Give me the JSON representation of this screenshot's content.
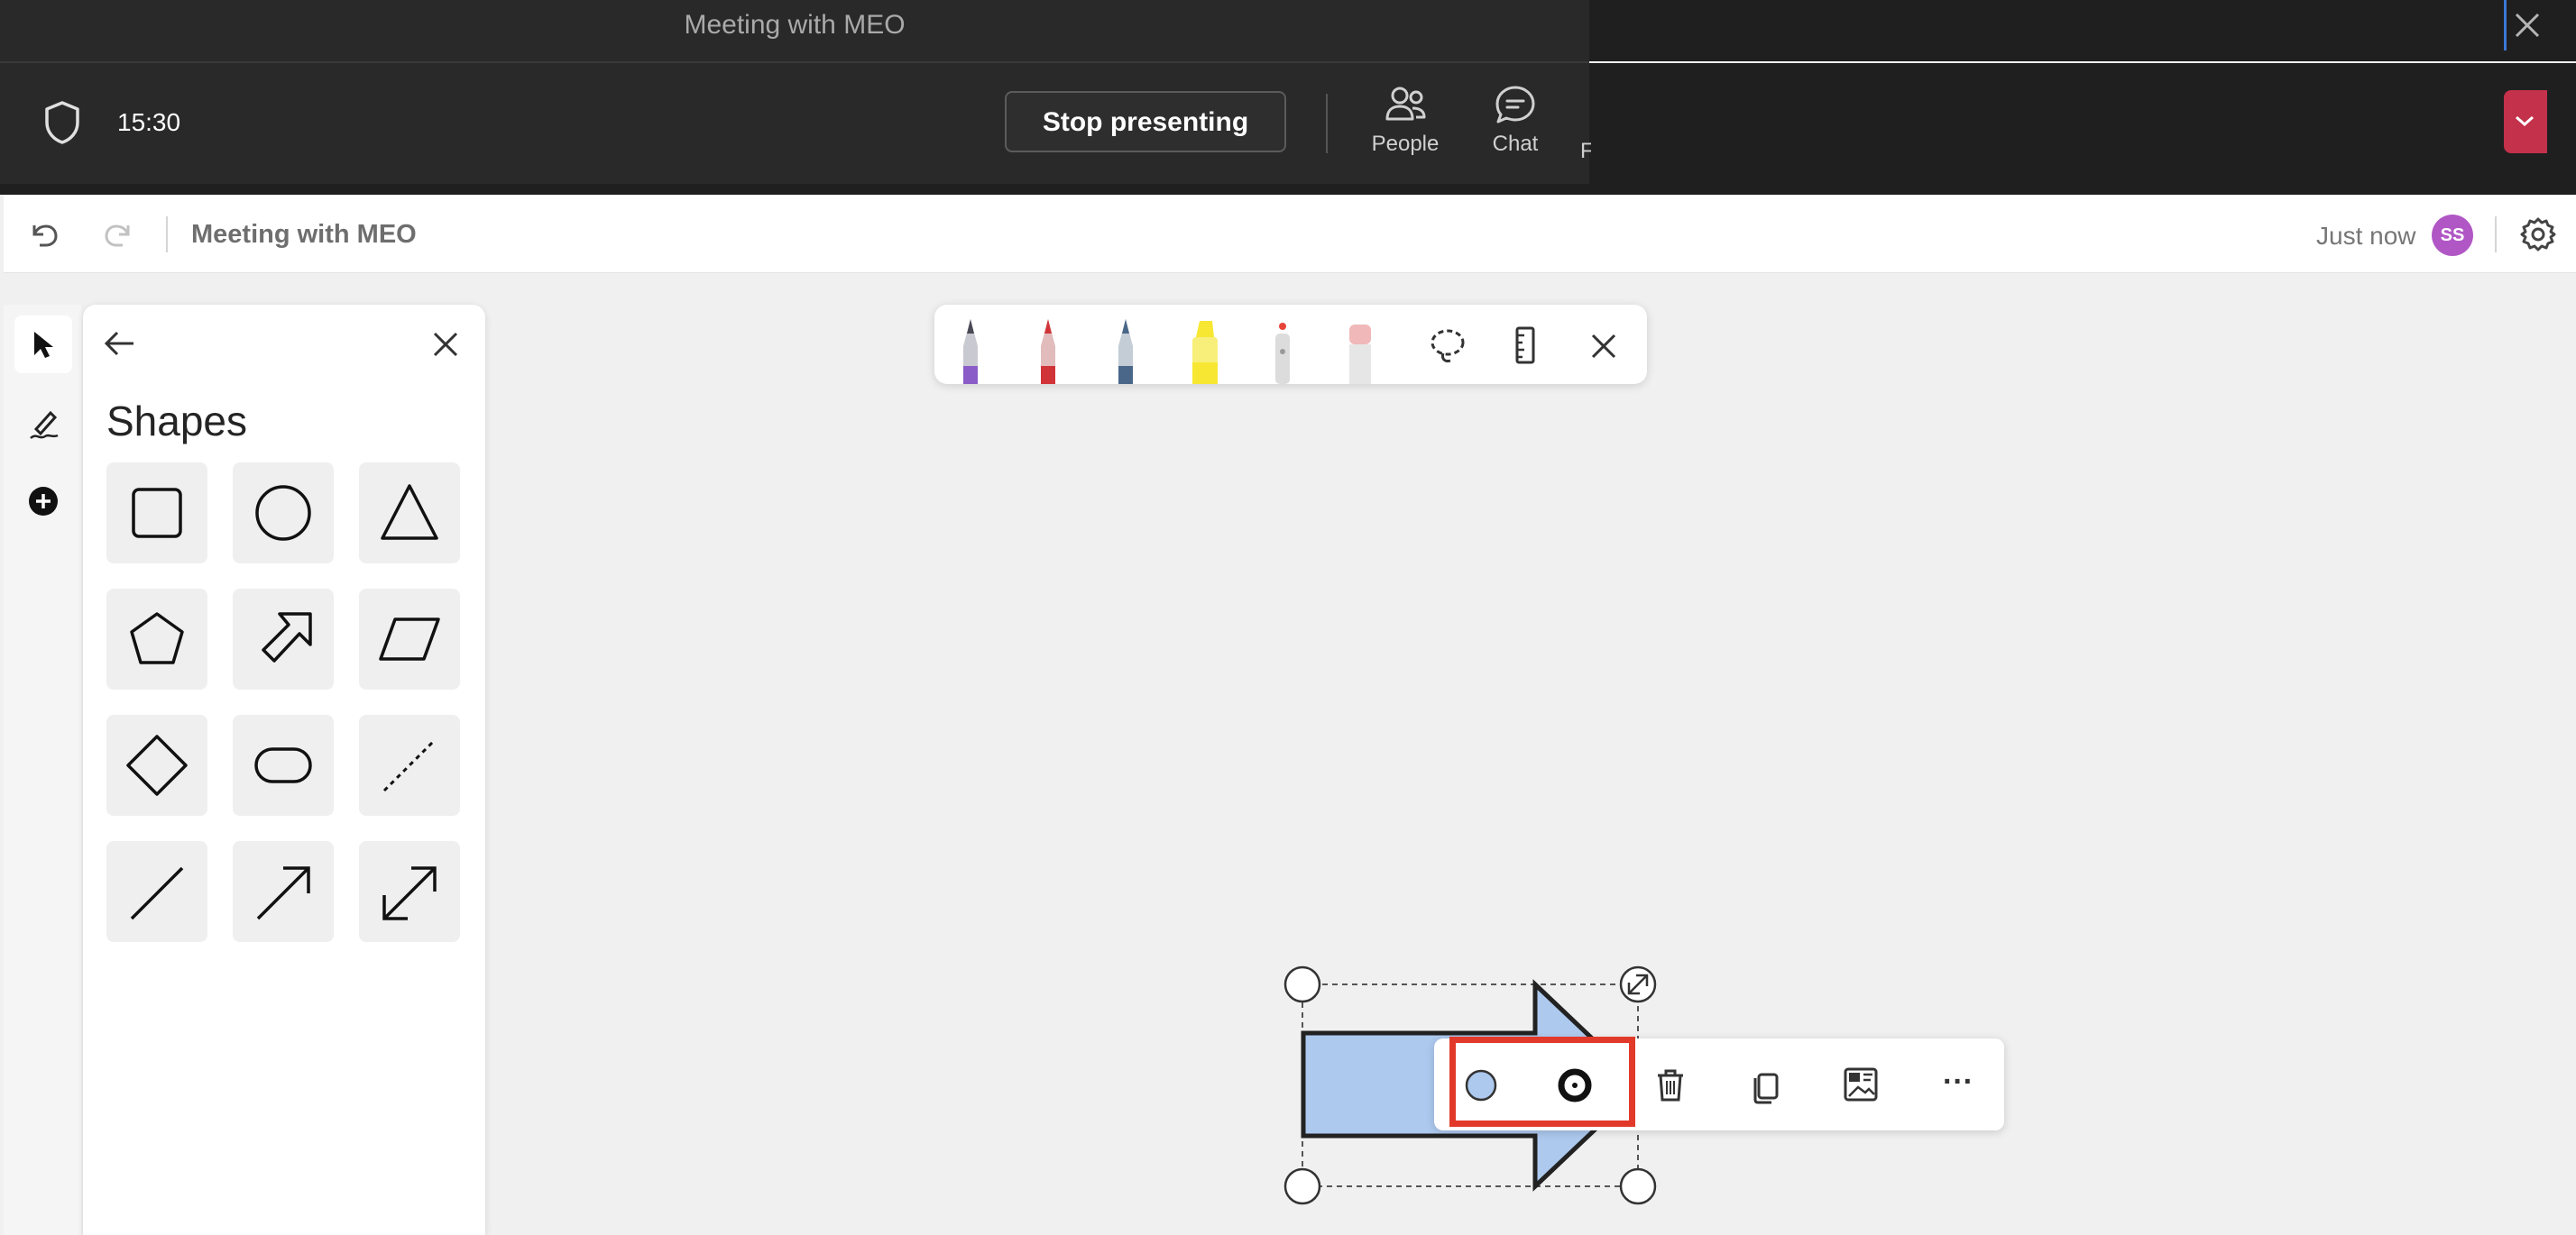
{
  "window": {
    "title": "Meeting with MEO"
  },
  "meeting_bar": {
    "timer": "15:30",
    "stop_presenting_label": "Stop presenting",
    "people_label": "People",
    "chat_label": "Chat",
    "cut_label": "F"
  },
  "whiteboard": {
    "title": "Meeting with MEO",
    "save_status": "Just now",
    "avatar_initials": "SS",
    "avatar_color": "#b057c5"
  },
  "shapes_panel": {
    "title": "Shapes",
    "shapes": [
      "square",
      "circle",
      "triangle",
      "pentagon",
      "arrow-block",
      "parallelogram",
      "diamond",
      "rounded-rectangle",
      "dashed-line",
      "line",
      "arrow",
      "double-arrow"
    ]
  },
  "pen_toolbar": {
    "pens": [
      {
        "name": "purple-pen",
        "color": "#8a5cc7"
      },
      {
        "name": "red-pen",
        "color": "#d13438"
      },
      {
        "name": "blue-pen",
        "color": "#4a6789"
      },
      {
        "name": "yellow-highlighter",
        "color": "#f7e733"
      },
      {
        "name": "red-laser",
        "color": "#e8443a"
      },
      {
        "name": "eraser",
        "color": "#f0b8b8"
      }
    ]
  },
  "canvas_shape": {
    "fill_color": "#adc9ee",
    "outline_color": "#222222",
    "type": "block-arrow"
  },
  "context_toolbar": {
    "fill_color": "#adc9ee",
    "more_label": "···"
  },
  "colors": {
    "highlight": "#e23a2a",
    "dark_bar": "#292929"
  }
}
